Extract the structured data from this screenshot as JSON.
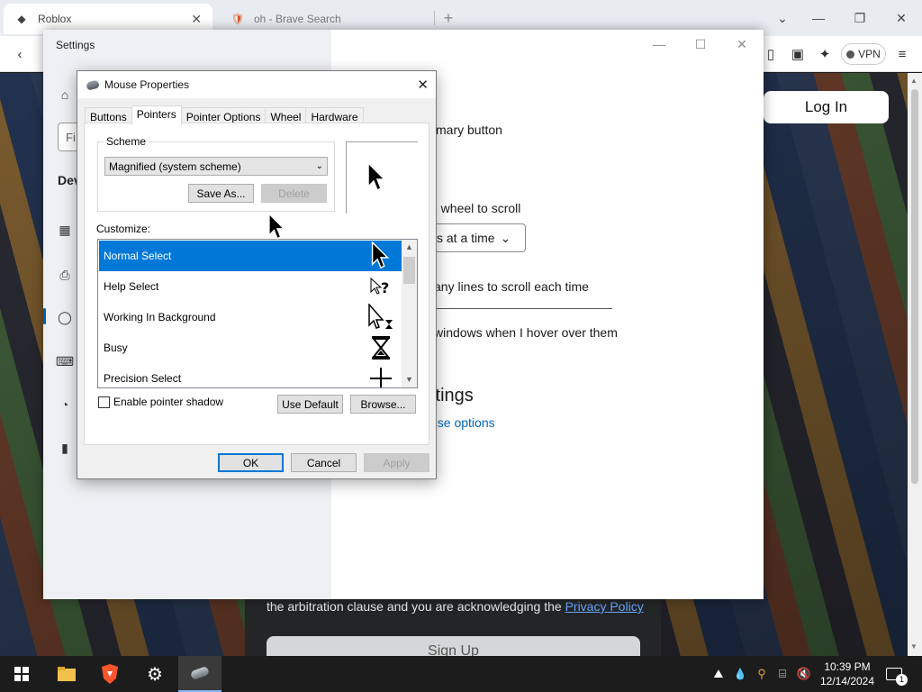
{
  "browser": {
    "tabs": [
      {
        "title": "Roblox",
        "active": true
      },
      {
        "title": "oh - Brave Search",
        "active": false
      }
    ],
    "vpn_label": "VPN",
    "icons": [
      "back-icon",
      "sidebar-icon",
      "wallet-icon",
      "leo-ai-icon",
      "menu-icon"
    ]
  },
  "webpage": {
    "login_label": "Log In",
    "legal_text": "the arbitration clause and you are acknowledging the ",
    "privacy_link": "Privacy Policy",
    "signup_label": "Sign Up"
  },
  "settings": {
    "title": "Settings",
    "find_placeholder": "Fi",
    "section_label": "Dev",
    "primary_button_text": "mary button",
    "scroll_text": "e wheel to scroll",
    "lines_dropdown": "s at a time",
    "lines_text": "any lines to scroll each time",
    "hover_text": "windows when I hover over them",
    "related_heading": "ttings",
    "mouse_options_link": "use options"
  },
  "dialog": {
    "title": "Mouse Properties",
    "tabs": [
      "Buttons",
      "Pointers",
      "Pointer Options",
      "Wheel",
      "Hardware"
    ],
    "selected_tab": "Pointers",
    "scheme_label": "Scheme",
    "scheme_value": "Magnified (system scheme)",
    "save_as_label": "Save As...",
    "delete_label": "Delete",
    "customize_label": "Customize:",
    "pointers": [
      {
        "label": "Normal Select",
        "icon": "arrow-cursor-icon",
        "selected": true
      },
      {
        "label": "Help Select",
        "icon": "help-cursor-icon",
        "selected": false
      },
      {
        "label": "Working In Background",
        "icon": "working-cursor-icon",
        "selected": false
      },
      {
        "label": "Busy",
        "icon": "hourglass-cursor-icon",
        "selected": false
      },
      {
        "label": "Precision Select",
        "icon": "crosshair-cursor-icon",
        "selected": false
      }
    ],
    "shadow_label": "Enable pointer shadow",
    "shadow_checked": false,
    "use_default_label": "Use Default",
    "browse_label": "Browse...",
    "ok_label": "OK",
    "cancel_label": "Cancel",
    "apply_label": "Apply"
  },
  "taskbar": {
    "time": "10:39 PM",
    "date": "12/14/2024",
    "notification_count": "1"
  }
}
